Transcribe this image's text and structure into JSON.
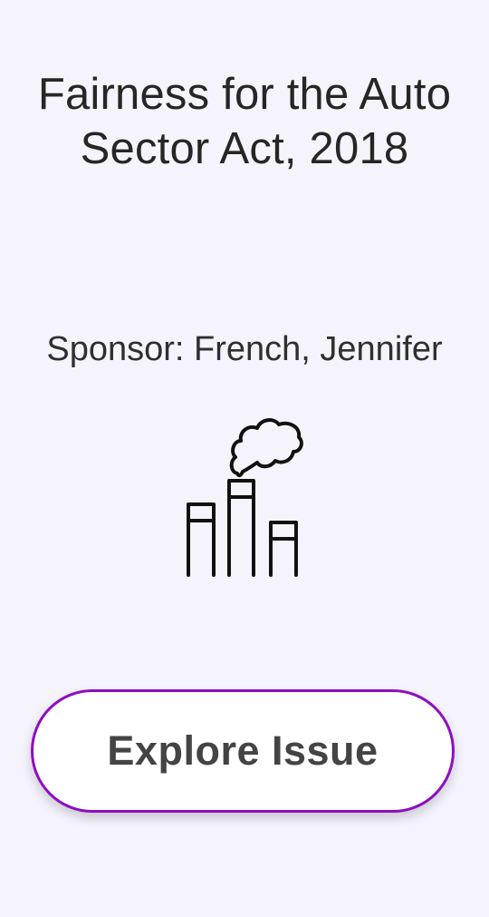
{
  "issue": {
    "title": "Fairness for the Auto Sector Act, 2018",
    "sponsor_prefix": "Sponsor: ",
    "sponsor_name": "French, Jennifer",
    "icon": "factory-smokestack-icon"
  },
  "actions": {
    "explore_label": "Explore Issue"
  },
  "colors": {
    "background": "#f5f4fd",
    "button_border": "#8e0fbf",
    "button_text": "#444444"
  }
}
